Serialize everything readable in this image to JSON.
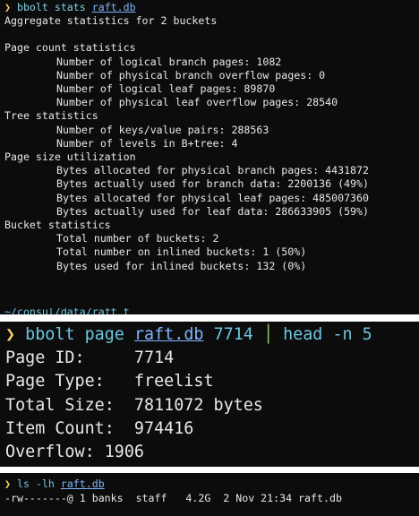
{
  "terminal1": {
    "prompt": "❯",
    "command": "bbolt stats",
    "file": "raft.db",
    "lines": [
      {
        "text": "Aggregate statistics for 2 buckets",
        "indent": false
      },
      {
        "text": "",
        "indent": false
      },
      {
        "text": "Page count statistics",
        "indent": false
      },
      {
        "text": "Number of logical branch pages: 1082",
        "indent": true
      },
      {
        "text": "Number of physical branch overflow pages: 0",
        "indent": true
      },
      {
        "text": "Number of logical leaf pages: 89870",
        "indent": true
      },
      {
        "text": "Number of physical leaf overflow pages: 28540",
        "indent": true
      },
      {
        "text": "Tree statistics",
        "indent": false
      },
      {
        "text": "Number of keys/value pairs: 288563",
        "indent": true
      },
      {
        "text": "Number of levels in B+tree: 4",
        "indent": true
      },
      {
        "text": "Page size utilization",
        "indent": false
      },
      {
        "text": "Bytes allocated for physical branch pages: 4431872",
        "indent": true
      },
      {
        "text": "Bytes actually used for branch data: 2200136 (49%)",
        "indent": true
      },
      {
        "text": "Bytes allocated for physical leaf pages: 485007360",
        "indent": true
      },
      {
        "text": "Bytes actually used for leaf data: 286633905 (59%)",
        "indent": true
      },
      {
        "text": "Bucket statistics",
        "indent": false
      },
      {
        "text": "Total number of buckets: 2",
        "indent": true
      },
      {
        "text": "Total number on inlined buckets: 1 (50%)",
        "indent": true
      },
      {
        "text": "Bytes used for inlined buckets: 132 (0%)",
        "indent": true
      }
    ],
    "cut_text": "~/consul/data/raft tail -f"
  },
  "terminal2": {
    "prompt": "❯",
    "command": "bbolt page",
    "file": "raft.db",
    "page_arg": "7714",
    "pipe": "│",
    "pipe_command": "head -n 5",
    "lines": [
      "Page ID:     7714",
      "Page Type:   freelist",
      "Total Size:  7811072 bytes",
      "Item Count:  974416",
      "Overflow: 1906"
    ]
  },
  "terminal3": {
    "prompt": "❯",
    "command": "ls -lh",
    "file": "raft.db",
    "output": "-rw-------@ 1 banks  staff   4.2G  2 Nov 21:34 raft.db"
  },
  "colors": {
    "background": "#0c0c0c",
    "text": "#e8e8e8",
    "prompt": "#f4d35e",
    "command": "#7fd3e6",
    "filename": "#7fb4ff",
    "pipe": "#9acd5f"
  }
}
